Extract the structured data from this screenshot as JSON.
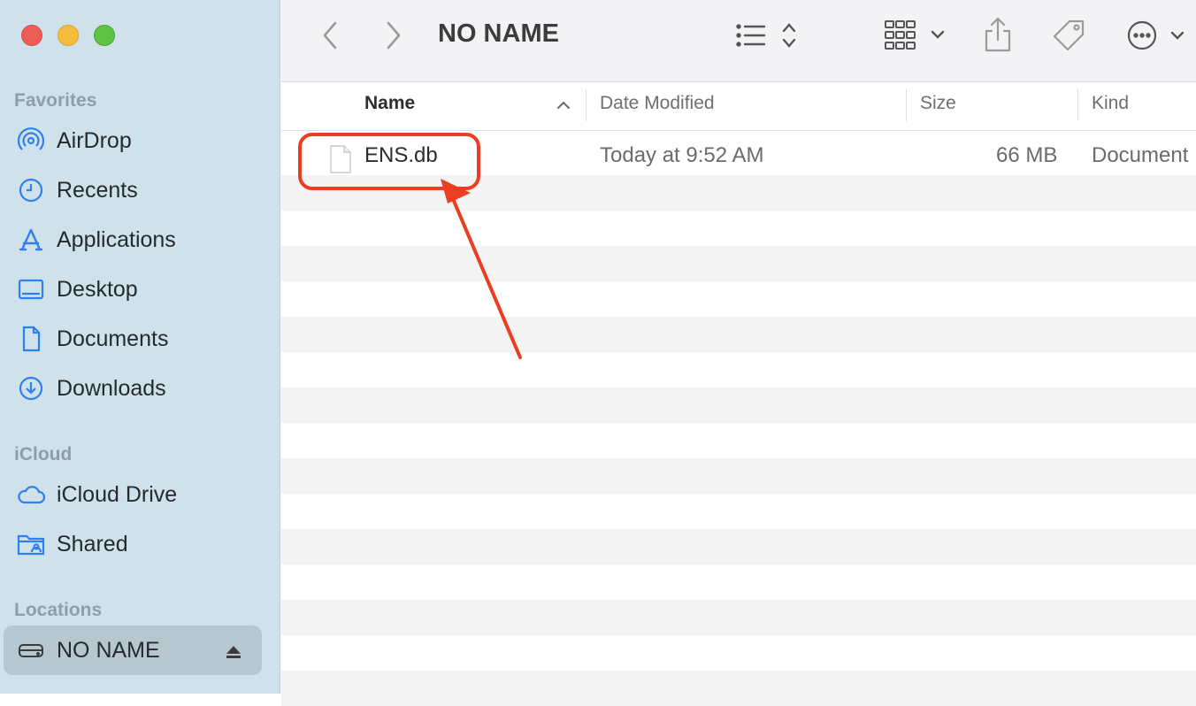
{
  "window": {
    "title": "NO NAME"
  },
  "sidebar": {
    "favorites_title": "Favorites",
    "favorites": [
      {
        "label": "AirDrop",
        "icon": "airdrop-icon"
      },
      {
        "label": "Recents",
        "icon": "clock-icon"
      },
      {
        "label": "Applications",
        "icon": "applications-icon"
      },
      {
        "label": "Desktop",
        "icon": "desktop-icon"
      },
      {
        "label": "Documents",
        "icon": "document-icon"
      },
      {
        "label": "Downloads",
        "icon": "downloads-icon"
      }
    ],
    "icloud_title": "iCloud",
    "icloud": [
      {
        "label": "iCloud Drive",
        "icon": "cloud-icon"
      },
      {
        "label": "Shared",
        "icon": "shared-folder-icon"
      }
    ],
    "locations_title": "Locations",
    "locations": [
      {
        "label": "NO NAME",
        "icon": "drive-icon",
        "selected": true
      }
    ]
  },
  "columns": {
    "name": "Name",
    "date": "Date Modified",
    "size": "Size",
    "kind": "Kind"
  },
  "files": [
    {
      "name": "ENS.db",
      "date": "Today at 9:52 AM",
      "size": "66 MB",
      "kind": "Document"
    }
  ],
  "colors": {
    "accent": "#2f80ed",
    "annotation": "#ec3d23",
    "sidebar_bg": "#cfe2ec"
  }
}
